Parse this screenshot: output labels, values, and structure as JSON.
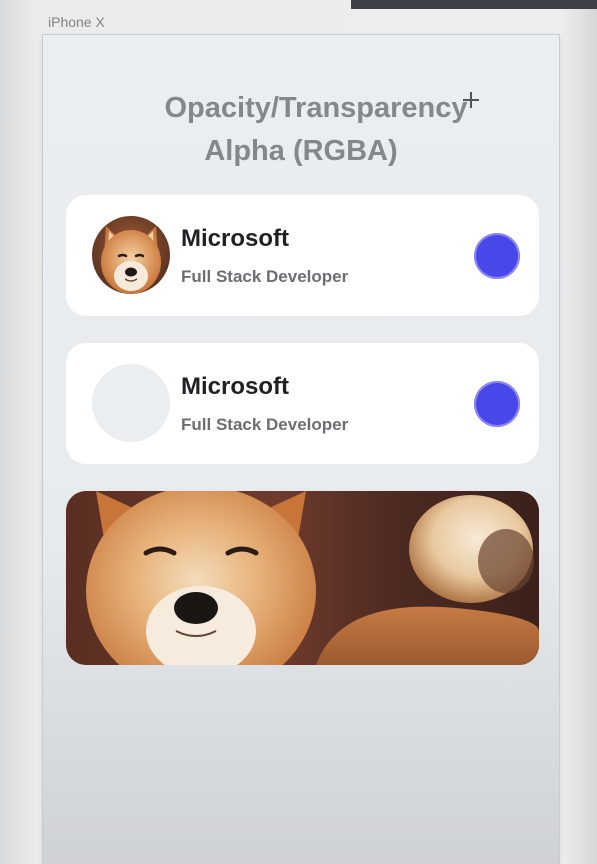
{
  "device": {
    "label": "iPhone X"
  },
  "header": {
    "title_line1": "Opacity/Transparency",
    "title_line2": "Alpha (RGBA)"
  },
  "cards": [
    {
      "title": "Microsoft",
      "subtitle": "Full Stack Developer",
      "avatar": "shiba-dog-photo",
      "accent": "#4a47e8"
    },
    {
      "title": "Microsoft",
      "subtitle": "Full Stack Developer",
      "avatar": "empty-placeholder",
      "accent": "#4a47e8"
    }
  ],
  "banner": {
    "image": "shiba-dog-banner"
  },
  "colors": {
    "accent": "#4a47e8",
    "card_bg": "#ffffff",
    "title_gray": "#85888b"
  }
}
